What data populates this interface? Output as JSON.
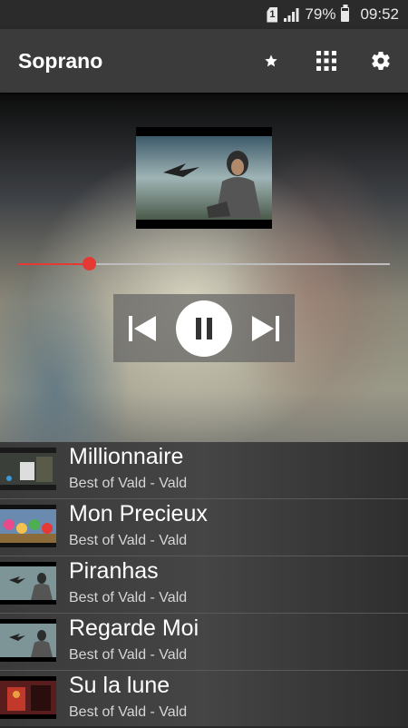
{
  "status_bar": {
    "sim": "1",
    "battery": "79%",
    "time": "09:52"
  },
  "app_bar": {
    "title": "Soprano",
    "actions": [
      "star-icon",
      "grid-icon",
      "gear-icon"
    ]
  },
  "player": {
    "progress": 0.19,
    "state": "playing",
    "controls": [
      "skip-previous-icon",
      "pause-icon",
      "skip-next-icon"
    ]
  },
  "tracks": [
    {
      "title": "Millionnaire",
      "subtitle": "Best of Vald - Vald",
      "thumb": "dark"
    },
    {
      "title": "Mon Precieux",
      "subtitle": "Best of Vald - Vald",
      "thumb": "colorful"
    },
    {
      "title": "Piranhas",
      "subtitle": "Best of Vald - Vald",
      "thumb": "album"
    },
    {
      "title": "Regarde Moi",
      "subtitle": "Best of Vald - Vald",
      "thumb": "album"
    },
    {
      "title": "Su la lune",
      "subtitle": "Best of Vald - Vald",
      "thumb": "red"
    }
  ],
  "colors": {
    "accent": "#e53935",
    "app_bar": "#3b3b3b",
    "status_bar": "#2b2b2b"
  }
}
